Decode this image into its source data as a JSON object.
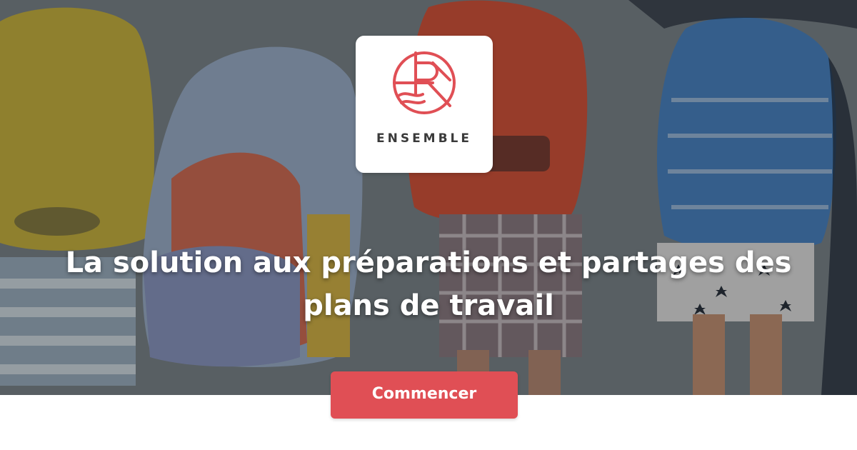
{
  "brand": {
    "name": "ENSEMBLE",
    "logo_icon": "ensemble-logo-icon",
    "accent_color": "#e04f55"
  },
  "hero": {
    "headline": "La solution aux préparations et partages des plans de travail",
    "background_description_icon": "children-backpacks-photo"
  },
  "cta": {
    "label": "Commencer",
    "color": "#e04f55"
  }
}
